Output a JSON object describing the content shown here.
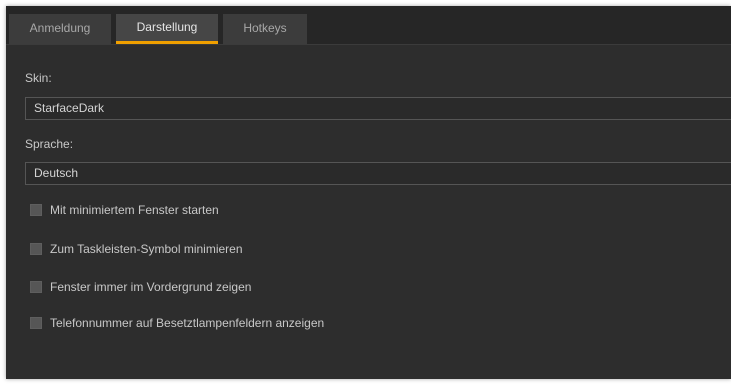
{
  "tabs": [
    {
      "label": "Anmeldung",
      "active": false
    },
    {
      "label": "Darstellung",
      "active": true
    },
    {
      "label": "Hotkeys",
      "active": false
    }
  ],
  "skin": {
    "label": "Skin:",
    "value": "StarfaceDark"
  },
  "language": {
    "label": "Sprache:",
    "value": "Deutsch"
  },
  "options": [
    {
      "label": "Mit minimiertem Fenster starten",
      "checked": false
    },
    {
      "label": "Zum Taskleisten-Symbol minimieren",
      "checked": false
    },
    {
      "label": "Fenster immer im Vordergrund zeigen",
      "checked": false
    },
    {
      "label": "Telefonnummer auf Besetztlampenfeldern anzeigen",
      "checked": false
    }
  ],
  "colors": {
    "accent": "#f0a000",
    "background": "#2d2d2d"
  }
}
